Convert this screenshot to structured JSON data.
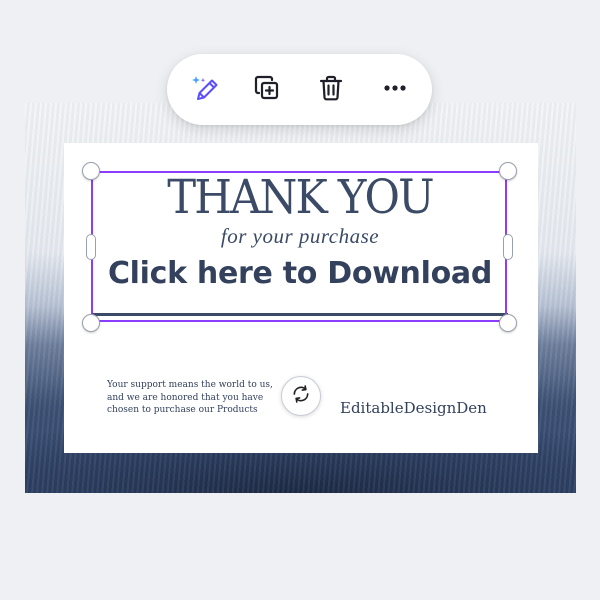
{
  "toolbar": {
    "buttons": [
      {
        "name": "magic-edit",
        "icon": "magic-pencil-icon"
      },
      {
        "name": "duplicate",
        "icon": "copy-plus-icon"
      },
      {
        "name": "delete",
        "icon": "trash-icon"
      },
      {
        "name": "more",
        "icon": "more-horizontal-icon"
      }
    ]
  },
  "card": {
    "title": "THANK YOU",
    "subtitle": "for your purchase",
    "download_text": "Click here to Download",
    "support_text": "Your support means the world to us,\nand we are honored that you have\nchosen to purchase our Products",
    "brand": "EditableDesignDen"
  },
  "colors": {
    "selection": "#8b3dff",
    "text": "#3b4a66",
    "magic_icon": "#5a4dff"
  },
  "rotate": {
    "icon": "rotate-icon"
  }
}
